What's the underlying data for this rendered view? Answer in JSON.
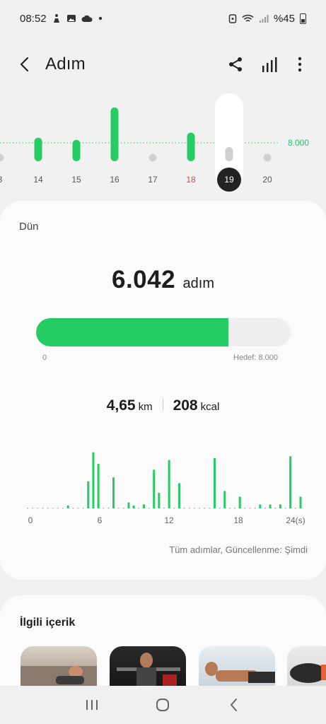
{
  "status_bar": {
    "time": "08:52",
    "battery": "%45",
    "left_icons": [
      "figure-icon",
      "image-icon",
      "cloud-icon",
      "dot-icon"
    ],
    "right_icons": [
      "alarm-icon",
      "wifi-icon",
      "signal-icon",
      "battery-icon"
    ]
  },
  "header": {
    "title": "Adım"
  },
  "daily_chart": {
    "goal_label": "8.000",
    "goal": 8000,
    "selected_day": "19",
    "accent_color": "#24cc63",
    "days": [
      {
        "label": "3",
        "steps": 0,
        "met": false,
        "weekend": false
      },
      {
        "label": "14",
        "steps": 4200,
        "met": false,
        "weekend": false
      },
      {
        "label": "15",
        "steps": 3800,
        "met": false,
        "weekend": false
      },
      {
        "label": "16",
        "steps": 9600,
        "met": true,
        "weekend": false
      },
      {
        "label": "17",
        "steps": 0,
        "met": false,
        "weekend": false
      },
      {
        "label": "18",
        "steps": 5100,
        "met": false,
        "weekend": true
      },
      {
        "label": "19",
        "steps": 0,
        "met": false,
        "weekend": false
      },
      {
        "label": "20",
        "steps": 0,
        "met": false,
        "weekend": false
      }
    ]
  },
  "summary": {
    "date_label": "Dün",
    "steps_value": "6.042",
    "steps_unit": "adım",
    "progress": 0.755,
    "progress_min_label": "0",
    "progress_goal_label": "Hedef: 8.000",
    "distance_value": "4,65",
    "distance_unit": "km",
    "calories_value": "208",
    "calories_unit": "kcal"
  },
  "hourly_chart": {
    "x_ticks": [
      "0",
      "6",
      "12",
      "18",
      "24(s)"
    ],
    "bars": [
      0,
      0,
      0,
      0,
      0,
      0,
      0,
      0,
      3,
      0,
      0,
      0,
      28,
      58,
      46,
      0,
      0,
      32,
      0,
      0,
      6,
      3,
      0,
      4,
      0,
      40,
      16,
      0,
      50,
      0,
      26,
      0,
      0,
      0,
      0,
      0,
      0,
      52,
      0,
      18,
      0,
      0,
      12,
      0,
      0,
      0,
      4,
      0,
      4,
      0,
      4,
      0,
      54,
      0,
      12
    ],
    "footnote": "Tüm adımlar, Güncellenme: Şimdi"
  },
  "related": {
    "title": "İlgili içerik"
  },
  "nav": {
    "icons": [
      "recents-icon",
      "home-icon",
      "back-icon"
    ]
  }
}
